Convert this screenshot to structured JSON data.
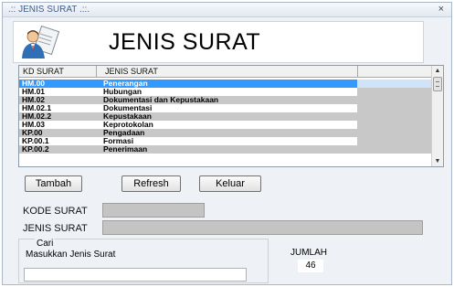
{
  "window": {
    "title": ".:: JENIS SURAT .::.",
    "close": "×"
  },
  "header": {
    "title": "JENIS SURAT"
  },
  "grid": {
    "columns": [
      "KD SURAT",
      "JENIS SURAT"
    ],
    "rows": [
      {
        "code": "HM.00",
        "name": "Penerangan",
        "selected": true
      },
      {
        "code": "HM.01",
        "name": "Hubungan"
      },
      {
        "code": "HM.02",
        "name": "Dokumentasi dan Kepustakaan"
      },
      {
        "code": "HM.02.1",
        "name": "Dokumentasi"
      },
      {
        "code": "HM.02.2",
        "name": "Kepustakaan"
      },
      {
        "code": "HM.03",
        "name": "Keprotokolan"
      },
      {
        "code": "KP.00",
        "name": "Pengadaan"
      },
      {
        "code": "KP.00.1",
        "name": "Formasi"
      },
      {
        "code": "KP.00.2",
        "name": "Penerimaan"
      }
    ]
  },
  "buttons": {
    "tambah": "Tambah",
    "refresh": "Refresh",
    "keluar": "Keluar"
  },
  "form": {
    "kode_label": "KODE SURAT",
    "kode_value": "",
    "jenis_label": "JENIS SURAT",
    "jenis_value": ""
  },
  "search": {
    "group_title": "Cari",
    "hint": "Masukkan Jenis Surat",
    "value": ""
  },
  "jumlah": {
    "label": "JUMLAH",
    "value": "46"
  },
  "colors": {
    "selection": "#3399ff",
    "alt_row": "#c8c8c8",
    "window_bg": "#eef1f5"
  },
  "icons": {
    "logo": "document-person-icon",
    "close": "close-icon"
  }
}
